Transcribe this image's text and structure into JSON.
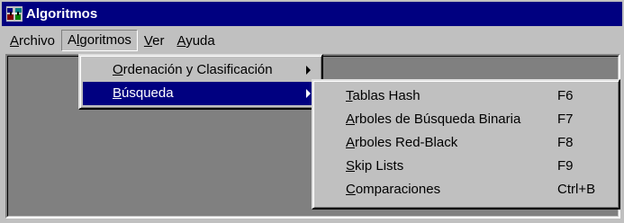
{
  "window": {
    "title": "Algoritmos"
  },
  "menubar": {
    "items": [
      {
        "pre": "",
        "key": "A",
        "post": "rchivo"
      },
      {
        "pre": "A",
        "key": "l",
        "post": "goritmos"
      },
      {
        "pre": "",
        "key": "V",
        "post": "er"
      },
      {
        "pre": "",
        "key": "A",
        "post": "yuda"
      }
    ]
  },
  "algoritmos_menu": {
    "items": [
      {
        "key": "O",
        "post": "rdenación y Clasificación"
      },
      {
        "key": "B",
        "post": "úsqueda"
      }
    ]
  },
  "busqueda_menu": {
    "items": [
      {
        "key": "T",
        "post": "ablas Hash",
        "shortcut": "F6"
      },
      {
        "key": "A",
        "post": "rboles de Búsqueda Binaria",
        "shortcut": "F7"
      },
      {
        "key": "A",
        "post": "rboles Red-Black",
        "shortcut": "F8"
      },
      {
        "key": "S",
        "post": "kip Lists",
        "shortcut": "F9"
      },
      {
        "key": "C",
        "post": "omparaciones",
        "shortcut": "Ctrl+B"
      }
    ]
  },
  "colors": {
    "titlebar": "#000080",
    "face": "#c0c0c0",
    "client": "#808080",
    "highlight": "#000080"
  }
}
